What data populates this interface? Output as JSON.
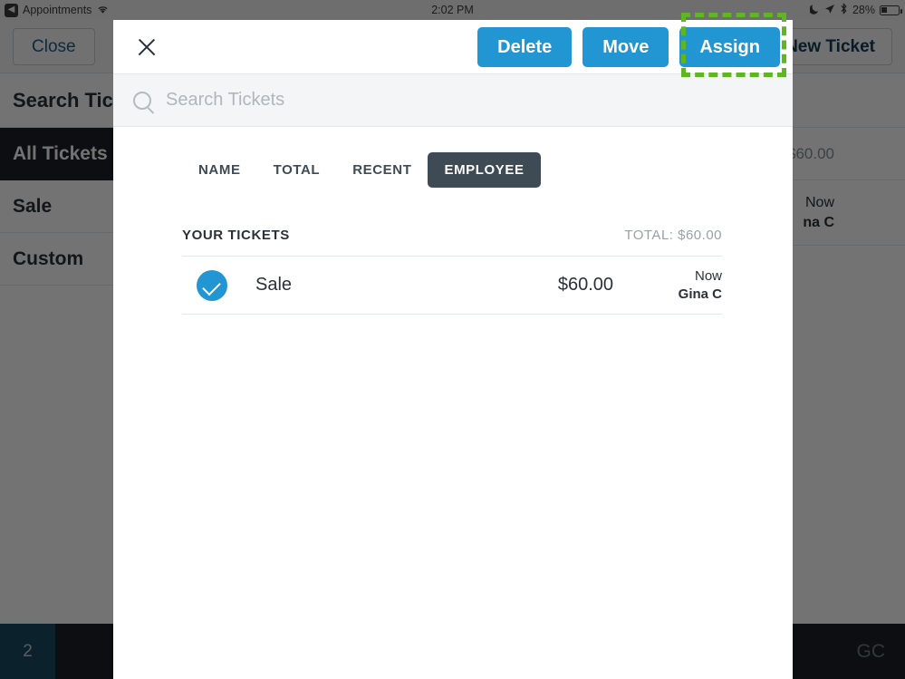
{
  "status_bar": {
    "back_icon": "chevron-left-icon",
    "back_label": "Appointments",
    "wifi_icon": "wifi-icon",
    "time": "2:02 PM",
    "dnd_icon": "moon-icon",
    "location_icon": "location-arrow-icon",
    "bluetooth_icon": "bluetooth-icon",
    "battery_percent": "28%",
    "battery_icon": "battery-icon"
  },
  "background_app": {
    "close_label": "Close",
    "new_ticket_label": "New Ticket",
    "search_heading": "Search Tickets",
    "sidebar_items": [
      {
        "label": "All Tickets",
        "active": true
      },
      {
        "label": "Sale",
        "active": false
      },
      {
        "label": "Custom",
        "active": false
      }
    ],
    "list_total": ": $60.00",
    "ticket_when": "Now",
    "ticket_who": "na C",
    "bottom_count": "2",
    "bottom_user": "GC"
  },
  "modal": {
    "close_icon": "close-icon",
    "actions": [
      {
        "label": "Delete",
        "name": "delete-button"
      },
      {
        "label": "Move",
        "name": "move-button"
      },
      {
        "label": "Assign",
        "name": "assign-button"
      }
    ],
    "search": {
      "icon": "search-icon",
      "value": "",
      "placeholder": "Search Tickets"
    },
    "sort_tabs": [
      {
        "label": "NAME",
        "active": false
      },
      {
        "label": "TOTAL",
        "active": false
      },
      {
        "label": "RECENT",
        "active": false
      },
      {
        "label": "EMPLOYEE",
        "active": true
      }
    ],
    "section": {
      "title": "YOUR TICKETS",
      "total": "TOTAL: $60.00"
    },
    "tickets": [
      {
        "selected": true,
        "check_icon": "check-circle-icon",
        "name": "Sale",
        "amount": "$60.00",
        "when": "Now",
        "who": "Gina C"
      }
    ]
  },
  "annotation": {
    "highlight_target": "assign-button",
    "highlight_color": "#5fb523"
  }
}
